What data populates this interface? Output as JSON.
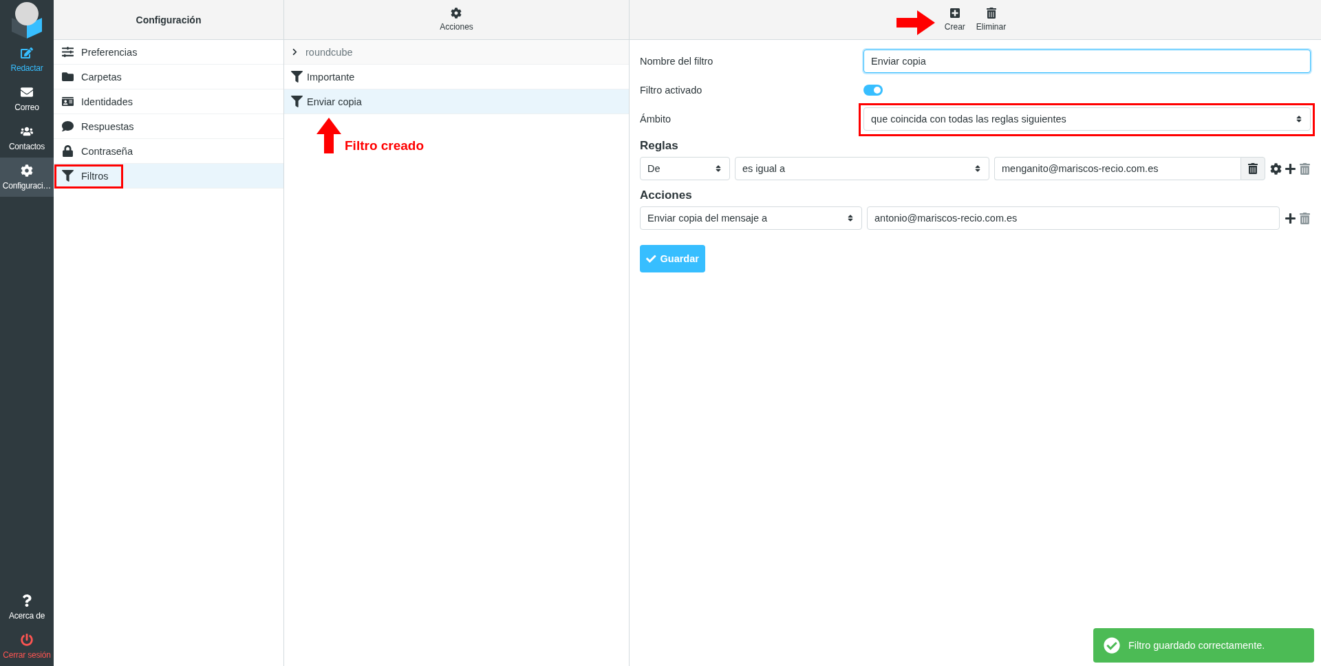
{
  "nav": {
    "items": [
      {
        "label": "Redactar",
        "kind": "compose",
        "selected": false
      },
      {
        "label": "Correo",
        "kind": "mail",
        "selected": false
      },
      {
        "label": "Contactos",
        "kind": "contacts",
        "selected": false
      },
      {
        "label": "Configuraci…",
        "kind": "settings",
        "selected": true
      }
    ],
    "bottom": [
      {
        "label": "Acerca de",
        "kind": "about"
      },
      {
        "label": "Cerrar sesión",
        "kind": "logout"
      }
    ]
  },
  "settings": {
    "title": "Configuración",
    "items": [
      {
        "label": "Preferencias",
        "kind": "prefs",
        "selected": false,
        "highlighted": false
      },
      {
        "label": "Carpetas",
        "kind": "folders",
        "selected": false,
        "highlighted": false
      },
      {
        "label": "Identidades",
        "kind": "identities",
        "selected": false,
        "highlighted": false
      },
      {
        "label": "Respuestas",
        "kind": "responses",
        "selected": false,
        "highlighted": false
      },
      {
        "label": "Contraseña",
        "kind": "password",
        "selected": false,
        "highlighted": false
      },
      {
        "label": "Filtros",
        "kind": "filters",
        "selected": true,
        "highlighted": true
      }
    ]
  },
  "filters": {
    "toolbar": {
      "label": "Acciones"
    },
    "set": {
      "label": "roundcube",
      "expanded": false
    },
    "items": [
      {
        "label": "Importante",
        "selected": false
      },
      {
        "label": "Enviar copia",
        "selected": true
      }
    ],
    "callout": "Filtro creado"
  },
  "editor": {
    "toolbar": [
      {
        "label": "Crear",
        "kind": "create",
        "annotated": true
      },
      {
        "label": "Eliminar",
        "kind": "delete",
        "annotated": false
      }
    ],
    "fields": [
      {
        "kind": "text",
        "label": "Nombre del filtro",
        "value": "Enviar copia",
        "focused": true,
        "highlighted": false
      },
      {
        "kind": "switch",
        "label": "Filtro activado",
        "on": true,
        "highlighted": false
      },
      {
        "kind": "select",
        "label": "Ámbito",
        "value": "que coincida con todas las reglas siguientes",
        "highlighted": true
      }
    ],
    "rules_title": "Reglas",
    "rules": [
      {
        "header": "De",
        "operator": "es igual a",
        "value": "menganito@mariscos-recio.com.es"
      }
    ],
    "actions_title": "Acciones",
    "actions": [
      {
        "type": "Enviar copia del mensaje a",
        "value": "antonio@mariscos-recio.com.es"
      }
    ],
    "save": "Guardar"
  },
  "toast": "Filtro guardado correctamente."
}
